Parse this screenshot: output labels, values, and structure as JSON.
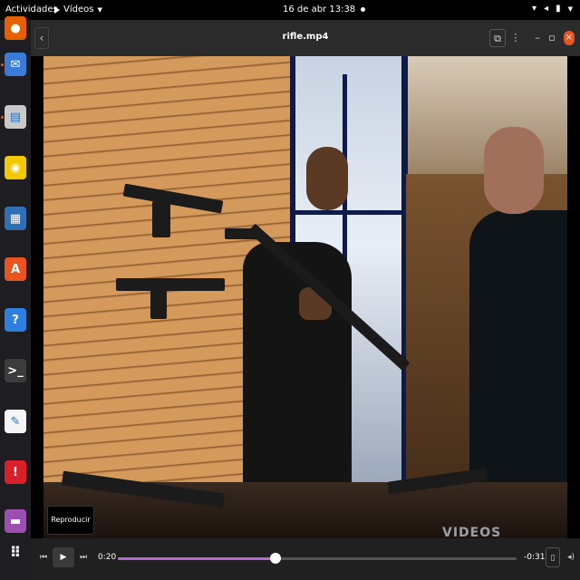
{
  "topbar": {
    "activities": "Actividades",
    "app_menu": "Vídeos",
    "clock": "16 de abr  13:38"
  },
  "dock": {
    "apps": [
      {
        "icon": "firefox-icon",
        "color": "#e66000"
      },
      {
        "icon": "thunderbird-icon",
        "color": "#3a7bd5"
      },
      {
        "icon": "files-icon",
        "color": "#c9c9c9"
      },
      {
        "icon": "rhythmbox-icon",
        "color": "#f2c900"
      },
      {
        "icon": "writer-icon",
        "color": "#2f6fb5"
      },
      {
        "icon": "software-icon",
        "color": "#e95420"
      },
      {
        "icon": "help-icon",
        "color": "#2f7fe0"
      },
      {
        "icon": "terminal-icon",
        "color": "#3c3c3c"
      },
      {
        "icon": "text-editor-icon",
        "color": "#f5f5f5"
      },
      {
        "icon": "update-icon",
        "color": "#d81f2a"
      },
      {
        "icon": "trash-icon",
        "color": "#9b4fb0"
      },
      {
        "icon": "show-apps-icon",
        "color": "#ffffff"
      }
    ]
  },
  "window": {
    "title": "rifle.mp4"
  },
  "video": {
    "watermark": "VIDEOS"
  },
  "tooltip": {
    "label": "Reproducir"
  },
  "controls": {
    "elapsed": "0:20",
    "remaining": "-0:31",
    "progress": 0.395,
    "accent": "#b86bd6"
  }
}
